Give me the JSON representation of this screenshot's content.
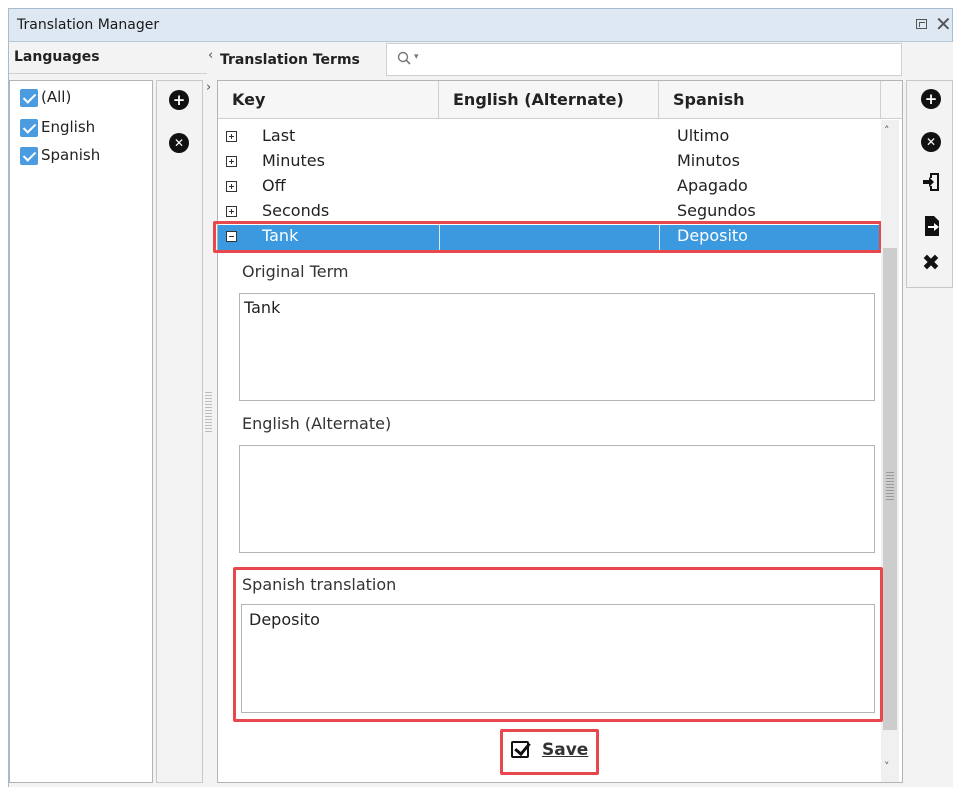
{
  "window": {
    "title": "Translation Manager"
  },
  "languages_panel": {
    "title": "Languages",
    "items": [
      {
        "label": "(All)",
        "checked": true
      },
      {
        "label": "English",
        "checked": true
      },
      {
        "label": "Spanish",
        "checked": true
      }
    ]
  },
  "terms_panel": {
    "title": "Translation Terms",
    "search": {
      "placeholder": "",
      "value": ""
    },
    "columns": [
      "Key",
      "English (Alternate)",
      "Spanish"
    ],
    "rows": [
      {
        "key": "Last",
        "english_alt": "",
        "spanish": "Ultimo",
        "expanded": false
      },
      {
        "key": "Minutes",
        "english_alt": "",
        "spanish": "Minutos",
        "expanded": false
      },
      {
        "key": "Off",
        "english_alt": "",
        "spanish": "Apagado",
        "expanded": false
      },
      {
        "key": "Seconds",
        "english_alt": "",
        "spanish": "Segundos",
        "expanded": false
      },
      {
        "key": "Tank",
        "english_alt": "",
        "spanish": "Deposito",
        "expanded": true,
        "selected": true
      }
    ]
  },
  "detail": {
    "original_label": "Original Term",
    "original_value": "Tank",
    "english_alt_label": "English (Alternate)",
    "english_alt_value": "",
    "spanish_label": "Spanish translation",
    "spanish_value": "Deposito"
  },
  "save_button": {
    "label": "Save"
  },
  "icons": {
    "add": "plus-circle-icon",
    "remove": "x-circle-icon",
    "import": "import-icon",
    "export": "export-icon",
    "tools": "tools-icon"
  },
  "colors": {
    "selection": "#3b99e0",
    "highlight": "#e8474c",
    "checkbox": "#4a9be0"
  }
}
